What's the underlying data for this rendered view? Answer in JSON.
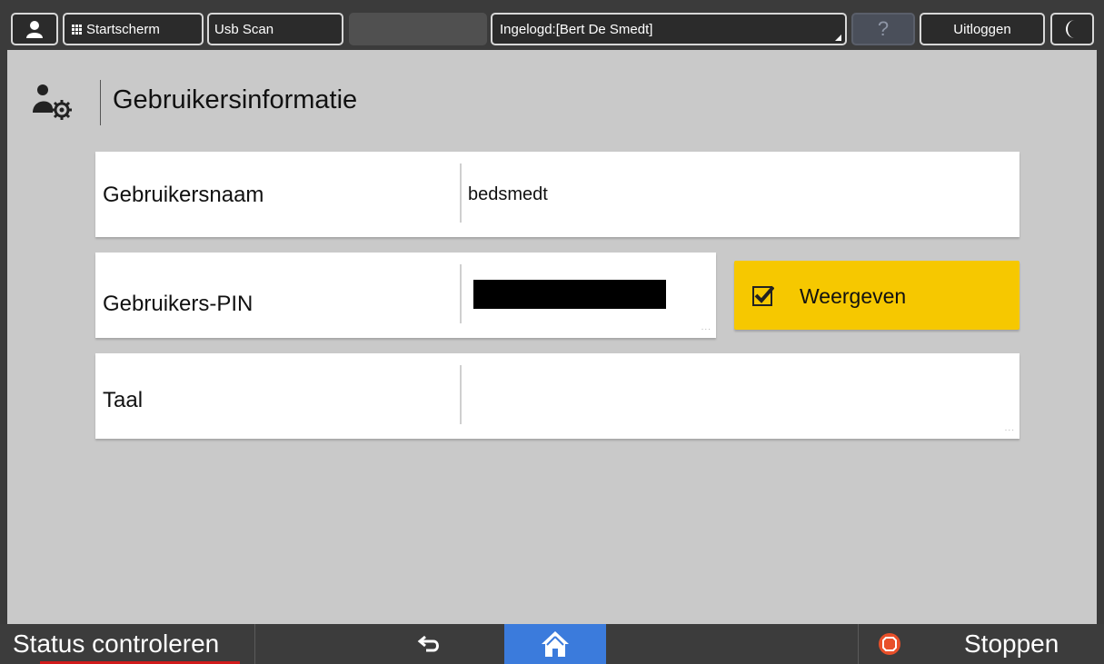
{
  "topbar": {
    "home_screen_label": "Startscherm",
    "usb_scan_label": "Usb Scan",
    "login_status": "Ingelogd:[Bert De Smedt]",
    "help_label": "?",
    "logout_label": "Uitloggen"
  },
  "header": {
    "title": "Gebruikersinformatie"
  },
  "fields": {
    "username": {
      "label": "Gebruikersnaam",
      "value": "bedsmedt"
    },
    "pin": {
      "label": "Gebruikers-PIN",
      "value_masked": true,
      "more_indicator": "..."
    },
    "language": {
      "label": "Taal",
      "value": "",
      "more_indicator": "..."
    }
  },
  "show_toggle": {
    "label": "Weergeven",
    "checked": true,
    "color": "#f6c800"
  },
  "bottombar": {
    "status_label": "Status controleren",
    "stop_label": "Stoppen",
    "home_color": "#3b7bdc",
    "stop_color": "#e8502a"
  },
  "icons": [
    "user-icon",
    "grid-icon",
    "help-icon",
    "moon-icon",
    "user-settings-icon",
    "check-icon",
    "back-arrow-icon",
    "home-icon",
    "stop-icon"
  ]
}
